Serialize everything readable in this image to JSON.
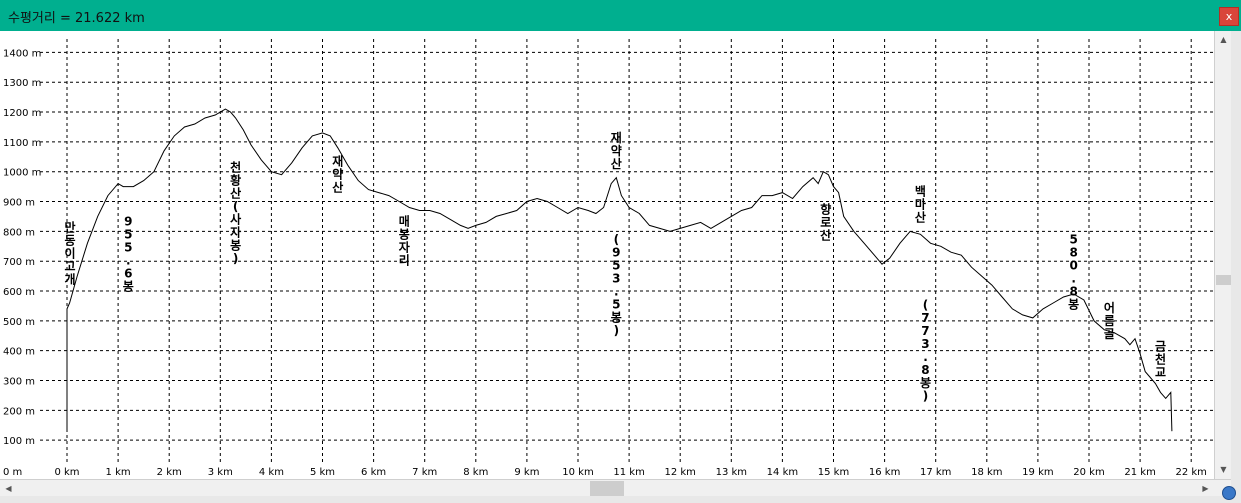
{
  "window": {
    "title": "수평거리 = 21.622 km",
    "close_label": "x"
  },
  "chart_data": {
    "type": "line",
    "title": "",
    "xlabel": "",
    "ylabel": "",
    "x_unit": "km",
    "y_unit": "m",
    "xlim": [
      0,
      22
    ],
    "ylim": [
      0,
      1400
    ],
    "x_ticks": [
      0,
      1,
      2,
      3,
      4,
      5,
      6,
      7,
      8,
      9,
      10,
      11,
      12,
      13,
      14,
      15,
      16,
      17,
      18,
      19,
      20,
      21,
      22
    ],
    "x_tick_labels": [
      "0 km",
      "1 km",
      "2 km",
      "3 km",
      "4 km",
      "5 km",
      "6 km",
      "7 km",
      "8 km",
      "9 km",
      "10 km",
      "11 km",
      "12 km",
      "13 km",
      "14 km",
      "15 km",
      "16 km",
      "17 km",
      "18 km",
      "19 km",
      "20 km",
      "21 km",
      "22 km"
    ],
    "y_ticks": [
      100,
      200,
      300,
      400,
      500,
      600,
      700,
      800,
      900,
      1000,
      1100,
      1200,
      1300,
      1400
    ],
    "y_tick_labels": [
      "100 m",
      "200 m",
      "300 m",
      "400 m",
      "500 m",
      "600 m",
      "700 m",
      "800 m",
      "900 m",
      "1000 m",
      "1100 m",
      "1200 m",
      "1300 m",
      "1400 m"
    ],
    "origin_label": "0 m",
    "grid": true,
    "series": [
      {
        "color": "#000000",
        "x": [
          0,
          0,
          0.05,
          0.2,
          0.4,
          0.6,
          0.8,
          1.0,
          1.1,
          1.3,
          1.5,
          1.7,
          1.9,
          2.1,
          2.3,
          2.5,
          2.7,
          2.9,
          3.1,
          3.2,
          3.3,
          3.45,
          3.6,
          3.8,
          4.0,
          4.2,
          4.4,
          4.6,
          4.8,
          5.0,
          5.15,
          5.3,
          5.5,
          5.7,
          5.9,
          6.1,
          6.3,
          6.5,
          6.7,
          6.9,
          7.1,
          7.3,
          7.5,
          7.7,
          7.85,
          8.0,
          8.2,
          8.4,
          8.6,
          8.8,
          9.0,
          9.2,
          9.4,
          9.6,
          9.8,
          10.0,
          10.2,
          10.35,
          10.5,
          10.65,
          10.75,
          10.85,
          11.0,
          11.2,
          11.4,
          11.6,
          11.8,
          12.0,
          12.2,
          12.4,
          12.6,
          12.8,
          13.0,
          13.2,
          13.4,
          13.6,
          13.8,
          14.0,
          14.2,
          14.4,
          14.6,
          14.7,
          14.8,
          14.9,
          15.0,
          15.1,
          15.2,
          15.4,
          15.6,
          15.8,
          15.95,
          16.1,
          16.3,
          16.5,
          16.7,
          16.9,
          17.1,
          17.3,
          17.5,
          17.7,
          17.9,
          18.1,
          18.3,
          18.5,
          18.7,
          18.9,
          19.1,
          19.3,
          19.5,
          19.7,
          19.9,
          20.1,
          20.3,
          20.5,
          20.7,
          20.8,
          20.9,
          21.0,
          21.1,
          21.2,
          21.3,
          21.4,
          21.5,
          21.55,
          21.6,
          21.622
        ],
        "y": [
          130,
          540,
          560,
          650,
          760,
          850,
          920,
          960,
          950,
          950,
          970,
          1000,
          1070,
          1120,
          1150,
          1160,
          1180,
          1190,
          1210,
          1200,
          1180,
          1140,
          1090,
          1040,
          1000,
          990,
          1030,
          1080,
          1120,
          1130,
          1120,
          1080,
          1020,
          970,
          940,
          930,
          920,
          900,
          880,
          870,
          870,
          860,
          840,
          820,
          810,
          820,
          830,
          850,
          860,
          870,
          900,
          910,
          900,
          880,
          860,
          880,
          870,
          860,
          880,
          960,
          980,
          920,
          880,
          860,
          820,
          810,
          800,
          810,
          820,
          830,
          810,
          830,
          850,
          870,
          880,
          920,
          920,
          930,
          910,
          950,
          980,
          960,
          1000,
          990,
          950,
          930,
          850,
          800,
          760,
          720,
          690,
          710,
          760,
          800,
          790,
          760,
          750,
          730,
          720,
          680,
          650,
          620,
          580,
          540,
          520,
          510,
          540,
          560,
          580,
          590,
          570,
          500,
          470,
          460,
          440,
          420,
          440,
          390,
          330,
          310,
          290,
          260,
          240,
          250,
          260,
          130
        ]
      }
    ],
    "annotations": [
      {
        "text": "만동이고개",
        "x": 0.06,
        "y": 800
      },
      {
        "text": "955.6봉",
        "x": 1.2,
        "y": 820
      },
      {
        "text": "천황산(사자봉)",
        "x": 3.3,
        "y": 1000
      },
      {
        "text": "재약산",
        "x": 5.3,
        "y": 1020
      },
      {
        "text": "매봉자리",
        "x": 6.6,
        "y": 820
      },
      {
        "text": "재약산",
        "x": 10.75,
        "y": 1100
      },
      {
        "text": "(953.5봉)",
        "x": 10.75,
        "y": 760
      },
      {
        "text": "향로산",
        "x": 14.85,
        "y": 860
      },
      {
        "text": "백마산",
        "x": 16.7,
        "y": 920
      },
      {
        "text": "(773.8봉)",
        "x": 16.8,
        "y": 540
      },
      {
        "text": "580.8봉",
        "x": 19.7,
        "y": 760
      },
      {
        "text": "어름골",
        "x": 20.4,
        "y": 530
      },
      {
        "text": "금천교",
        "x": 21.4,
        "y": 400
      }
    ]
  }
}
